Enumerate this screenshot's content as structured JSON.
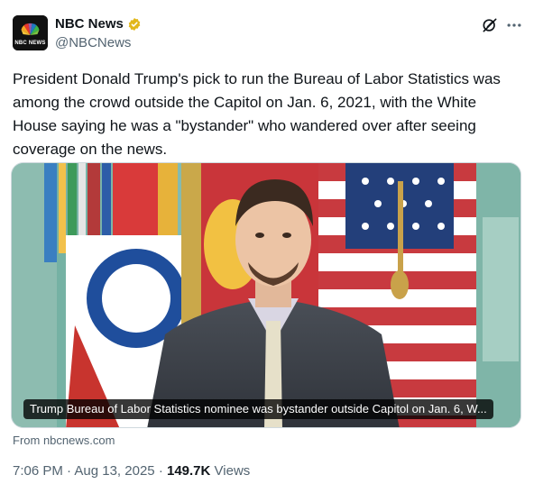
{
  "author": {
    "display_name": "NBC News",
    "handle": "@NBCNews",
    "avatar_text": "NBC NEWS",
    "verified": true
  },
  "tweet": {
    "text": "President Donald Trump's pick to run the Bureau of Labor Statistics was among the crowd outside the Capitol on Jan. 6, 2021, with the White House saying he was a \"bystander\" who wandered over after seeing coverage on the news."
  },
  "card": {
    "caption": "Trump Bureau of Labor Statistics nominee was bystander outside Capitol on Jan. 6, W...",
    "source": "From nbcnews.com"
  },
  "meta": {
    "time": "7:06 PM",
    "separator": "·",
    "date": "Aug 13, 2025",
    "views_count": "149.7K",
    "views_label": "Views"
  },
  "icons": {
    "verified": "verified-badge-icon",
    "grok": "grok-icon",
    "more": "more-icon"
  },
  "colors": {
    "text": "#0f1419",
    "secondary": "#536471",
    "verified_gold": "#e2b719"
  }
}
